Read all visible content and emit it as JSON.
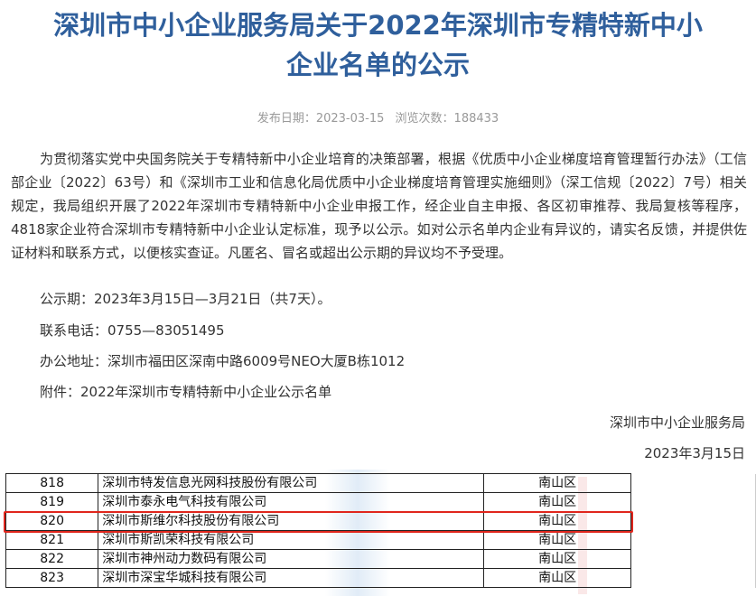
{
  "title": {
    "line1": "深圳市中小企业服务局关于2022年深圳市专精特新中小",
    "line2": "企业名单的公示"
  },
  "meta": {
    "date_label": "发布日期：",
    "date_value": "2023-03-15",
    "views_label": "浏览次数：",
    "views_value": "188433"
  },
  "body": {
    "paragraph": "为贯彻落实党中央国务院关于专精特新中小企业培育的决策部署，根据《优质中小企业梯度培育管理暂行办法》（工信部企业〔2022〕63号）和《深圳市工业和信息化局优质中小企业梯度培育管理实施细则》（深工信规〔2022〕7号）相关规定，我局组织开展了2022年深圳市专精特新中小企业申报工作，经企业自主申报、各区初审推荐、我局复核等程序，4818家企业符合深圳市专精特新中小企业认定标准，现予以公示。如对公示名单内企业有异议的，请实名反馈，并提供佐证材料和联系方式，以便核实查证。凡匿名、冒名或超出公示期的异议均不予受理。",
    "period": "公示期：2023年3月15日—3月21日（共7天）。",
    "phone": "联系电话：0755—83051495",
    "address": "办公地址：深圳市福田区深南中路6009号NEO大厦B栋1012",
    "attachment": "附件：2022年深圳市专精特新中小企业公示名单",
    "signature_org": "深圳市中小企业服务局",
    "signature_date": "2023年3月15日"
  },
  "table": {
    "rows": [
      {
        "no": "818",
        "name": "深圳市特发信息光网科技股份有限公司",
        "district": "南山区"
      },
      {
        "no": "819",
        "name": "深圳市泰永电气科技有限公司",
        "district": "南山区"
      },
      {
        "no": "820",
        "name": "深圳市斯维尔科技股份有限公司",
        "district": "南山区"
      },
      {
        "no": "821",
        "name": "深圳市斯凯荣科技有限公司",
        "district": "南山区"
      },
      {
        "no": "822",
        "name": "深圳市神州动力数码有限公司",
        "district": "南山区"
      },
      {
        "no": "823",
        "name": "深圳市深宝华城科技有限公司",
        "district": "南山区"
      }
    ],
    "highlight_color": "#e0261d"
  },
  "colors": {
    "title": "#2f5f9c",
    "meta": "#999999",
    "text": "#333333"
  }
}
